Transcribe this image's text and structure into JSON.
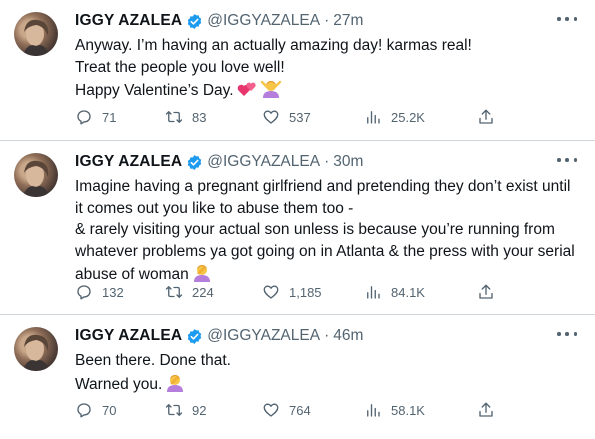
{
  "colors": {
    "text": "#0f1419",
    "muted": "#536471",
    "verified": "#1d9bf0",
    "divider": "#d0d5d9"
  },
  "tweets": [
    {
      "name": "IGGY AZALEA",
      "handle": "@IGGYAZALEA",
      "separator": "·",
      "time": "27m",
      "lines": [
        "Anyway. I’m having an actually amazing day! karmas real!",
        "Treat the people you love well!",
        "Happy Valentine’s Day."
      ],
      "emojis": [
        "two-hearts-icon",
        "woman-gesturing-ok-icon"
      ],
      "replies": "71",
      "retweets": "83",
      "likes": "537",
      "views": "25.2K"
    },
    {
      "name": "IGGY AZALEA",
      "handle": "@IGGYAZALEA",
      "separator": "·",
      "time": "30m",
      "lines": [
        "Imagine having a pregnant girlfriend and pretending they don’t exist until",
        "it comes out you like to abuse them too -",
        "& rarely visiting your actual son unless is because you’re running from",
        "whatever problems ya got going on in Atlanta & the press with your serial",
        "abuse of woman"
      ],
      "emojis": [
        "woman-facepalming-icon"
      ],
      "replies": "132",
      "retweets": "224",
      "likes": "1,185",
      "views": "84.1K"
    },
    {
      "name": "IGGY AZALEA",
      "handle": "@IGGYAZALEA",
      "separator": "·",
      "time": "46m",
      "lines": [
        "Been there. Done that.",
        "Warned you."
      ],
      "emojis": [
        "woman-facepalming-icon"
      ],
      "replies": "70",
      "retweets": "92",
      "likes": "764",
      "views": "58.1K"
    }
  ]
}
